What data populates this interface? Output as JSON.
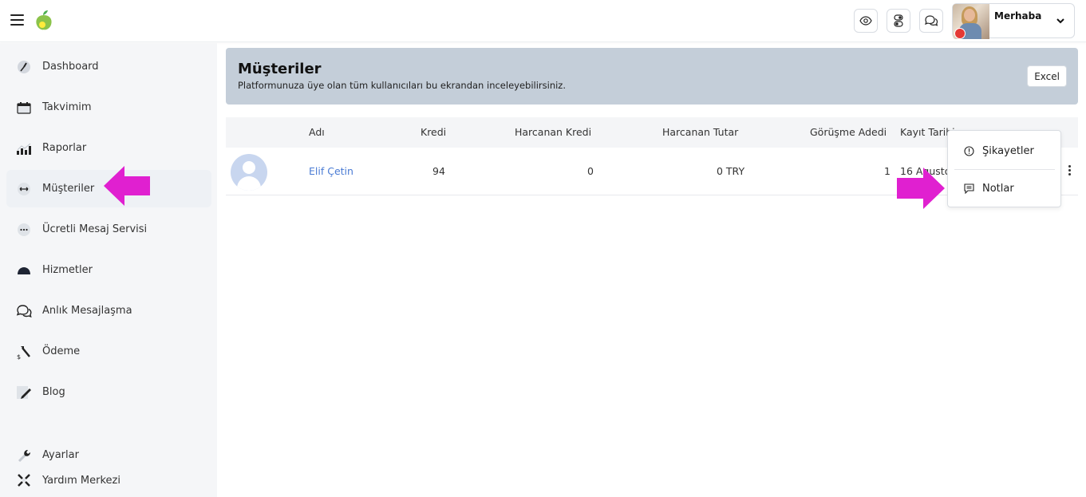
{
  "header": {
    "user_greeting": "Merhaba"
  },
  "sidebar": {
    "items": [
      {
        "label": "Dashboard",
        "icon": "dashboard-icon"
      },
      {
        "label": "Takvimim",
        "icon": "calendar-icon"
      },
      {
        "label": "Raporlar",
        "icon": "bar-chart-icon"
      },
      {
        "label": "Müşteriler",
        "icon": "customers-icon",
        "active": true
      },
      {
        "label": "Ücretli Mesaj Servisi",
        "icon": "chat-dots-icon"
      },
      {
        "label": "Hizmetler",
        "icon": "service-icon"
      },
      {
        "label": "Anlık Mesajlaşma",
        "icon": "messages-icon"
      },
      {
        "label": "Ödeme",
        "icon": "payment-icon"
      },
      {
        "label": "Blog",
        "icon": "blog-icon"
      }
    ],
    "bottom_items": [
      {
        "label": "Ayarlar",
        "icon": "wrench-icon"
      },
      {
        "label": "Yardım Merkezi",
        "icon": "help-icon"
      }
    ]
  },
  "page": {
    "title": "Müşteriler",
    "subtitle": "Platformunuza üye olan tüm kullanıcıları bu ekrandan inceleyebilirsiniz.",
    "excel_label": "Excel"
  },
  "table": {
    "columns": [
      "Adı",
      "Kredi",
      "Harcanan Kredi",
      "Harcanan Tutar",
      "Görüşme Adedi",
      "Kayıt Tarihi"
    ],
    "rows": [
      {
        "name": "Elif Çetin",
        "credit": "94",
        "spent_credit": "0",
        "spent_amount": "0 TRY",
        "meetings": "1",
        "registered": "16 Agustos"
      }
    ]
  },
  "dropdown": {
    "items": [
      {
        "label": "Şikayetler",
        "icon": "alert-circle-icon"
      },
      {
        "label": "Notlar",
        "icon": "note-icon"
      }
    ]
  },
  "colors": {
    "highlight_arrow": "#e020d0",
    "header_card": "#c4ced9",
    "link": "#4a7bd4",
    "status_dot": "#e53935"
  }
}
